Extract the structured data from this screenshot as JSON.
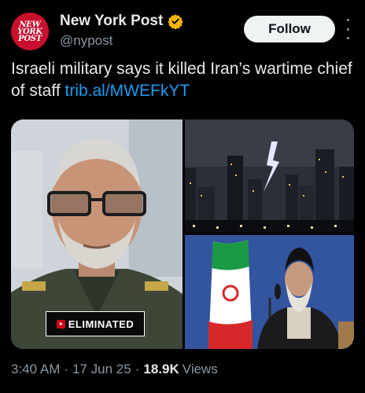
{
  "account": {
    "display_name": "New York Post",
    "handle": "@nypost",
    "avatar_text": [
      "NEW",
      "YORK",
      "POST"
    ],
    "verified_badge_color": "#f4b400"
  },
  "actions": {
    "follow_label": "Follow"
  },
  "tweet": {
    "text": "Israeli military says it killed Iran’s wartime chief of staff ",
    "link": "trib.al/MWEFkYT"
  },
  "media": {
    "overlay_label": "ELIMINATED"
  },
  "meta": {
    "time": "3:40 AM",
    "date": "17 Jun 25",
    "views_count": "18.9K",
    "views_label": "Views",
    "separator": "·"
  },
  "colors": {
    "background": "#000000",
    "text": "#e7e9ea",
    "muted": "#8b98a5",
    "link": "#1d9bf0",
    "brand": "#c8102e"
  }
}
